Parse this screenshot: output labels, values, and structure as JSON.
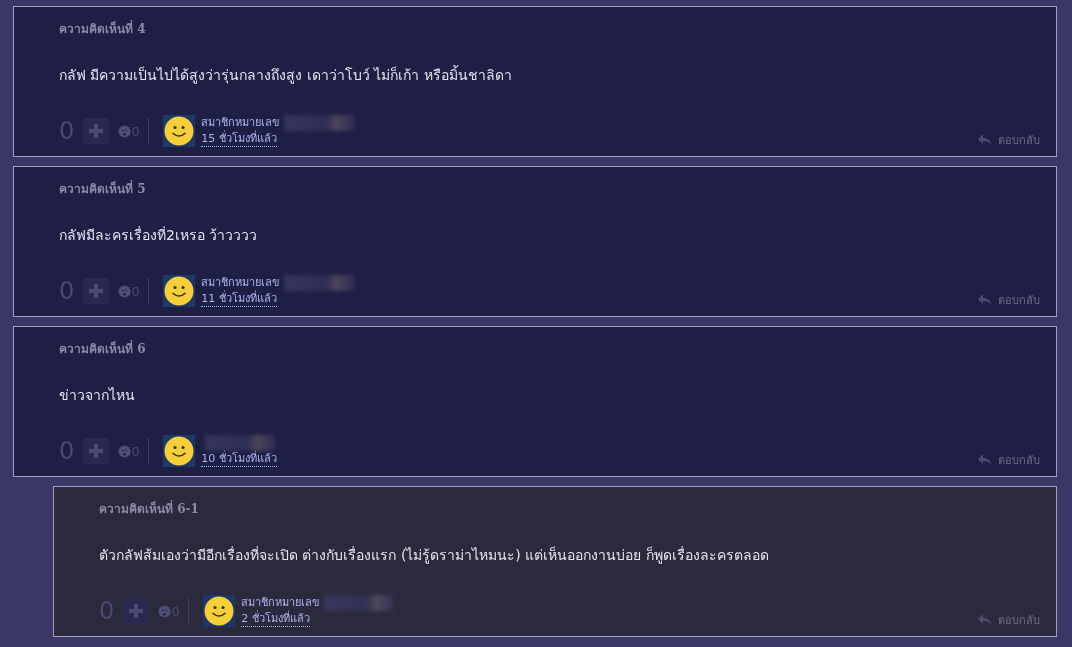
{
  "comments": [
    {
      "kind": "comment",
      "label": "ความคิดเห็นที่ 4",
      "text": "กลัฟ มีความเป็นไปได้สูงว่ารุ่นกลางถึงสูง เดาว่าโบว์ ไม่ก็เก้า หรือมิ้นชาลิดา",
      "score": "0",
      "emotion_count": "0",
      "member": "สมาชิกหมายเลข",
      "time": "15 ชั่วโมงที่แล้ว",
      "reply": "ตอบกลับ"
    },
    {
      "kind": "comment",
      "label": "ความคิดเห็นที่ 5",
      "text": "กลัฟมีละครเรื่องที่2เหรอ ว้าวววว",
      "score": "0",
      "emotion_count": "0",
      "member": "สมาชิกหมายเลข",
      "time": "11 ชั่วโมงที่แล้ว",
      "reply": "ตอบกลับ"
    },
    {
      "kind": "comment",
      "label": "ความคิดเห็นที่ 6",
      "text": "ข่าวจากไหน",
      "score": "0",
      "emotion_count": "0",
      "time": "10 ชั่วโมงที่แล้ว",
      "reply": "ตอบกลับ"
    },
    {
      "kind": "reply",
      "label": "ความคิดเห็นที่ 6-1",
      "text": "ตัวกลัฟส้มเองว่ามีอีกเรื่องที่จะเปิด ต่างกับเรื่องแรก (ไม่รู้ดราม่าไหมนะ) แต่เห็นออกงานบ่อย ก็พูดเรื่องละครตลอด",
      "score": "0",
      "emotion_count": "0",
      "member": "สมาชิกหมายเลข",
      "time": "2 ชั่วโมงที่แล้ว",
      "reply": "ตอบกลับ"
    }
  ]
}
